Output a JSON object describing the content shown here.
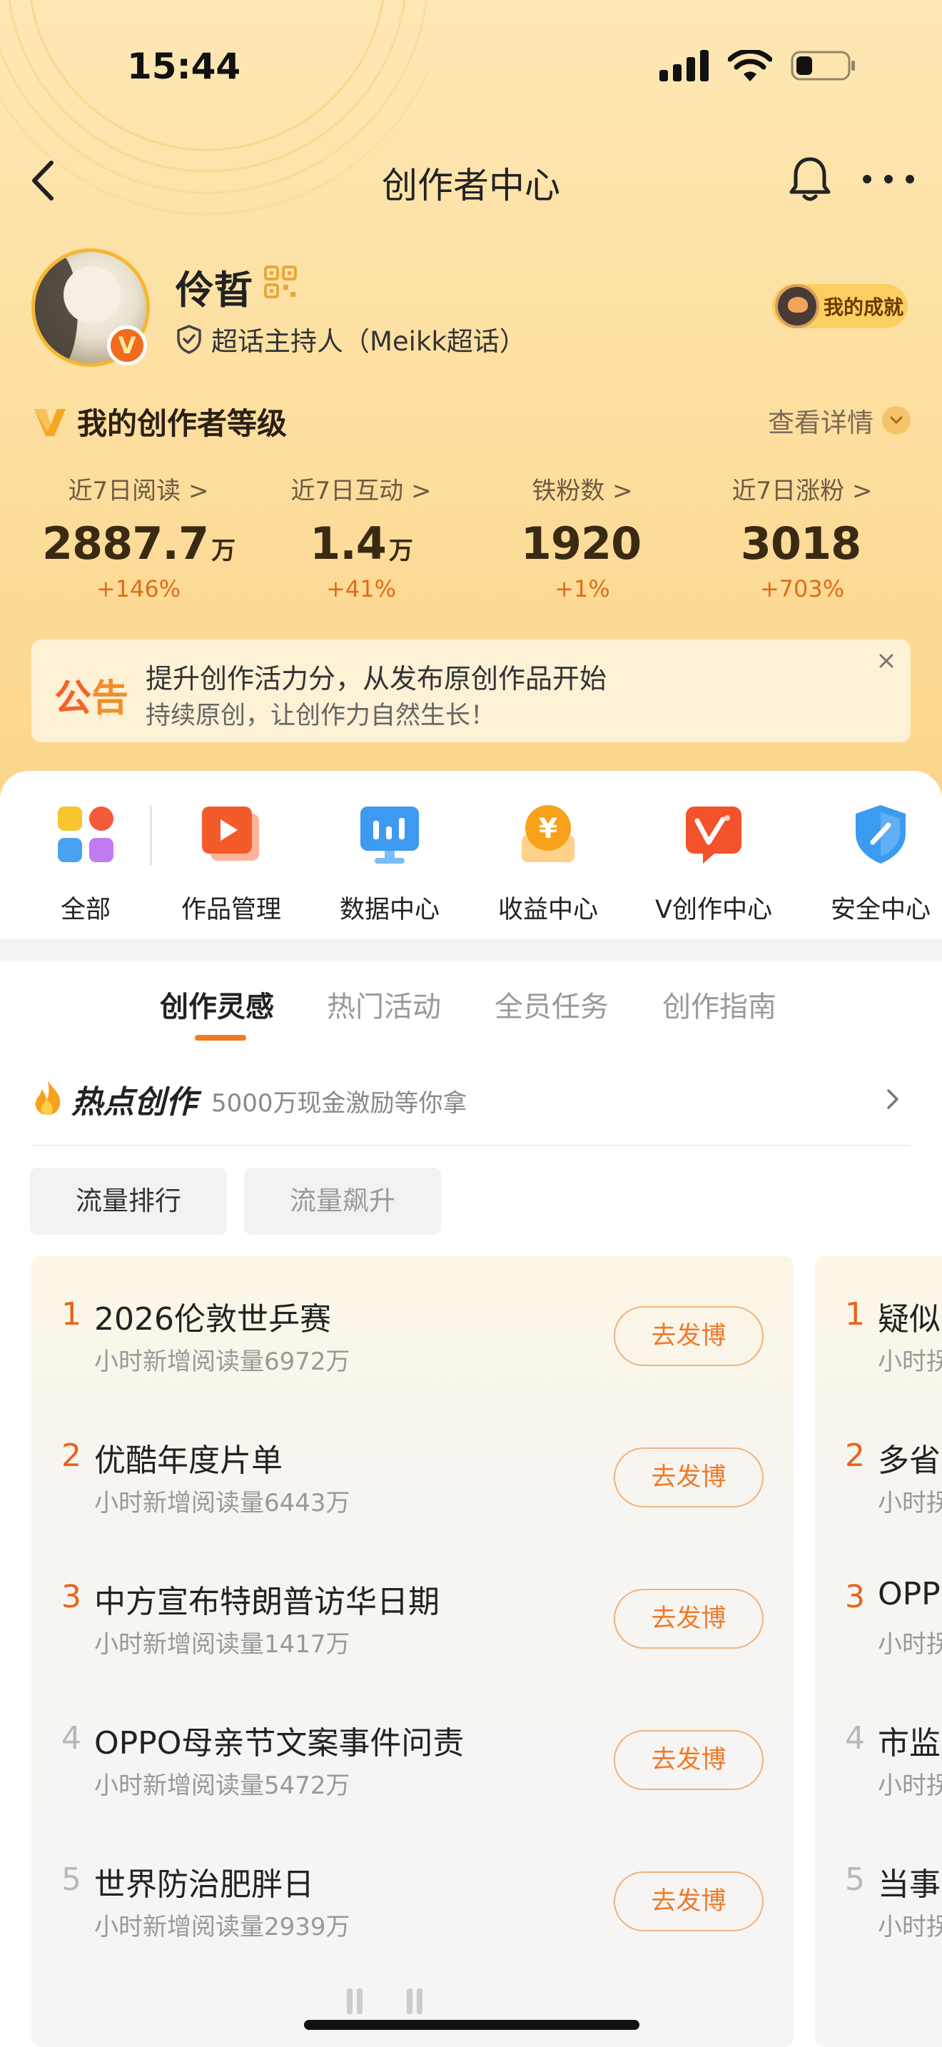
{
  "status_bar": {
    "time": "15:44"
  },
  "nav": {
    "title": "创作者中心"
  },
  "profile": {
    "username": "伶晢",
    "verified_badge": "V",
    "role": "超话主持人（Meikk超话）",
    "achievement_label": "我的成就"
  },
  "level": {
    "title": "我的创作者等级",
    "detail_label": "查看详情"
  },
  "stats": [
    {
      "label": "近7日阅读 >",
      "value": "2887.7",
      "unit": "万",
      "change": "+146%"
    },
    {
      "label": "近7日互动 >",
      "value": "1.4",
      "unit": "万",
      "change": "+41%"
    },
    {
      "label": "铁粉数 >",
      "value": "1920",
      "unit": "",
      "change": "+1%"
    },
    {
      "label": "近7日涨粉 >",
      "value": "3018",
      "unit": "",
      "change": "+703%"
    }
  ],
  "notice": {
    "tag_a": "公",
    "tag_b": "告",
    "line1": "提升创作活力分，从发布原创作品开始",
    "line2": "持续原创，让创作力自然生长！"
  },
  "shortcuts": [
    {
      "label": "全部",
      "icon": "grid-apps-icon"
    },
    {
      "label": "作品管理",
      "icon": "video-play-icon"
    },
    {
      "label": "数据中心",
      "icon": "data-chart-icon"
    },
    {
      "label": "收益中心",
      "icon": "yuan-coin-icon"
    },
    {
      "label": "V创作中心",
      "icon": "v-creator-icon"
    },
    {
      "label": "安全中心",
      "icon": "shield-pen-icon"
    }
  ],
  "tabs": [
    "创作灵感",
    "热门活动",
    "全员任务",
    "创作指南"
  ],
  "hot": {
    "title": "热点创作",
    "subtitle": "5000万现金激励等你拿"
  },
  "filters": [
    "流量排行",
    "流量飙升"
  ],
  "colors": {
    "accent": "#f27a1c",
    "rank_top": "#e8641b",
    "rank_other": "#b8b8b8"
  },
  "ranking": [
    {
      "rank": "1",
      "title": "2026伦敦世乒赛",
      "sub": "小时新增阅读量6972万",
      "button": "去发博"
    },
    {
      "rank": "2",
      "title": "优酷年度片单",
      "sub": "小时新增阅读量6443万",
      "button": "去发博"
    },
    {
      "rank": "3",
      "title": "中方宣布特朗普访华日期",
      "sub": "小时新增阅读量1417万",
      "button": "去发博"
    },
    {
      "rank": "4",
      "title": "OPPO母亲节文案事件问责",
      "sub": "小时新增阅读量5472万",
      "button": "去发博"
    },
    {
      "rank": "5",
      "title": "世界防治肥胖日",
      "sub": "小时新增阅读量2939万",
      "button": "去发博"
    }
  ],
  "ranking2": [
    {
      "rank": "1",
      "title": "疑似",
      "sub": "小时拐"
    },
    {
      "rank": "2",
      "title": "多省",
      "sub": "小时拐"
    },
    {
      "rank": "3",
      "title": "OPP",
      "sub": "小时拐"
    },
    {
      "rank": "4",
      "title": "市监",
      "sub": "小时拐"
    },
    {
      "rank": "5",
      "title": "当事",
      "sub": "小时拐"
    }
  ]
}
